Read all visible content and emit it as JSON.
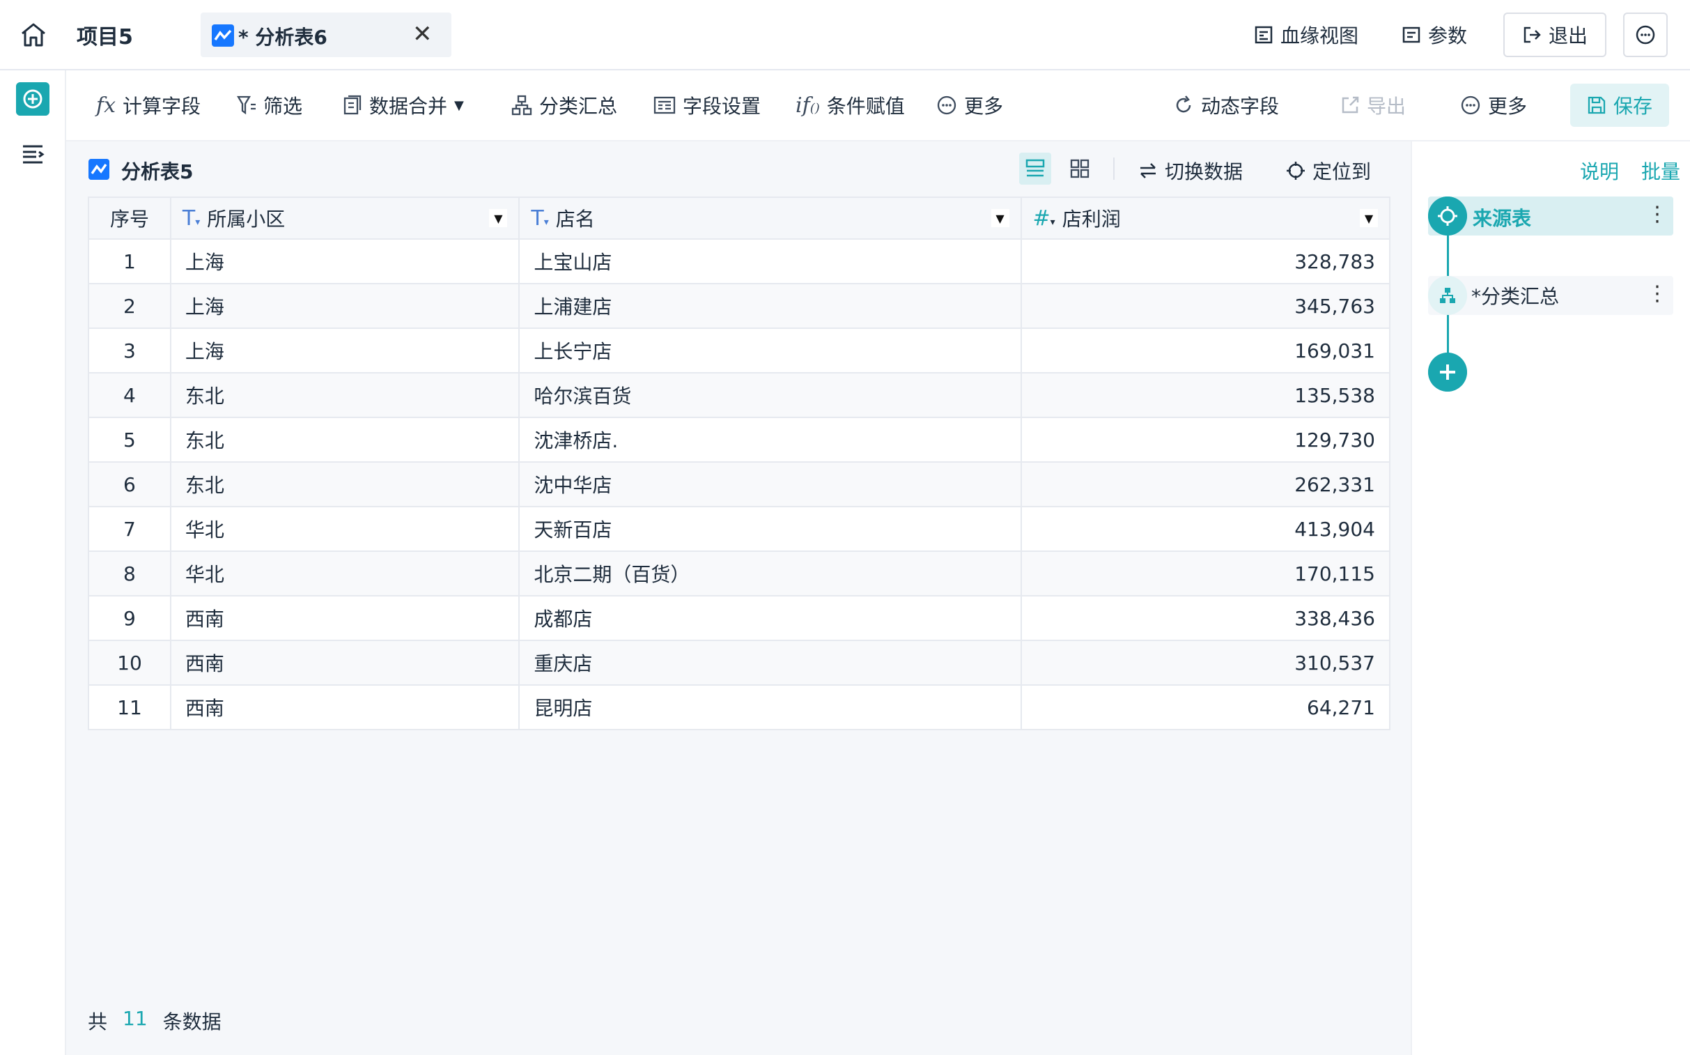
{
  "topbar": {
    "project_title": "项目5",
    "tab_label": "* 分析表6",
    "lineage_label": "血缘视图",
    "params_label": "参数",
    "exit_label": "退出"
  },
  "toolbar": {
    "calc_field": "计算字段",
    "filter": "筛选",
    "merge": "数据合并",
    "group_summary": "分类汇总",
    "field_settings": "字段设置",
    "conditional_assign": "条件赋值",
    "more_left": "更多",
    "dynamic_field": "动态字段",
    "export": "导出",
    "more_right": "更多",
    "save": "保存"
  },
  "table": {
    "title": "分析表5",
    "switch_data": "切换数据",
    "locate": "定位到",
    "columns": {
      "idx": "序号",
      "region": "所属小区",
      "store": "店名",
      "profit": "店利润"
    },
    "rows": [
      {
        "idx": "1",
        "region": "上海",
        "store": "上宝山店",
        "profit": "328,783"
      },
      {
        "idx": "2",
        "region": "上海",
        "store": "上浦建店",
        "profit": "345,763"
      },
      {
        "idx": "3",
        "region": "上海",
        "store": "上长宁店",
        "profit": "169,031"
      },
      {
        "idx": "4",
        "region": "东北",
        "store": "哈尔滨百货",
        "profit": "135,538"
      },
      {
        "idx": "5",
        "region": "东北",
        "store": "沈津桥店.",
        "profit": "129,730"
      },
      {
        "idx": "6",
        "region": "东北",
        "store": "沈中华店",
        "profit": "262,331"
      },
      {
        "idx": "7",
        "region": "华北",
        "store": "天新百店",
        "profit": "413,904"
      },
      {
        "idx": "8",
        "region": "华北",
        "store": "北京二期（百货）",
        "profit": "170,115"
      },
      {
        "idx": "9",
        "region": "西南",
        "store": "成都店",
        "profit": "338,436"
      },
      {
        "idx": "10",
        "region": "西南",
        "store": "重庆店",
        "profit": "310,537"
      },
      {
        "idx": "11",
        "region": "西南",
        "store": "昆明店",
        "profit": "64,271"
      }
    ]
  },
  "footer": {
    "prefix": "共",
    "count": "11",
    "suffix": "条数据"
  },
  "panel": {
    "desc_link": "说明",
    "batch_link": "批量",
    "source_node": "来源表",
    "agg_node": "*分类汇总"
  },
  "colors": {
    "accent": "#1aa7b0",
    "tab_icon": "#1677ff"
  }
}
